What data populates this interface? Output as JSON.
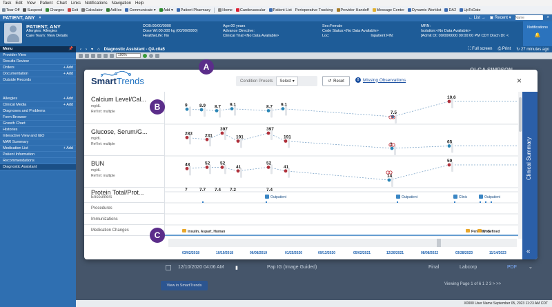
{
  "menubar": [
    "Task",
    "Edit",
    "View",
    "Patient",
    "Chart",
    "Links",
    "Notifications",
    "Navigation",
    "Help"
  ],
  "toolbar": [
    "Tear Off",
    "Suspend",
    "Charges",
    "Exit",
    "Calculator",
    "AdHoc",
    "Communicate",
    "Add",
    "Patient Pharmacy",
    "Home",
    "Cardiovascular",
    "Patient List",
    "Perioperative Tracking",
    "Provider Handoff",
    "Message Center",
    "Dynamic Worklist",
    "DA2",
    "UpToDate"
  ],
  "patientbar": {
    "name": "PATIENT, ANY",
    "list": "List",
    "recent": "Recent",
    "search_placeholder": "Name"
  },
  "demographics": {
    "name": "PATIENT, ANY",
    "allergies": "Allergies: Allergies",
    "careteam": "Care Team: View Details",
    "dob": "DOB:00/00/0000",
    "dose": "Dose Wt:00.000 kg (00/00/0000)",
    "healthelife": "HealtheLife: No",
    "age": "Age:00 years",
    "advdir": "Advance Directive:",
    "trial": "Clinical Trial:<No Data Available>",
    "sex": "Sex:Female",
    "code": "Code Status:<No Data Available>",
    "loc": "Loc:",
    "fin": "Inpatient FIN:",
    "mrn": "MRN:",
    "isolation": "Isolation:<No Data Available>",
    "admit": "[Admit Dt: 00/00/0000 00:00:00 PM CDT Disch Dt: <",
    "notifications": "Notifications"
  },
  "sidebar": {
    "header": "Menu",
    "items": [
      {
        "label": "Provider View",
        "add": ""
      },
      {
        "label": "Results Review",
        "add": ""
      },
      {
        "label": "Orders",
        "add": "+ Add"
      },
      {
        "label": "Documentation",
        "add": "+ Add"
      },
      {
        "label": "Outside Records",
        "add": ""
      },
      {
        "label": "",
        "add": ""
      },
      {
        "label": "",
        "add": ""
      },
      {
        "label": "Allergies",
        "add": "+ Add"
      },
      {
        "label": "Clinical Media",
        "add": "+ Add"
      },
      {
        "label": "Diagnoses and Problems",
        "add": ""
      },
      {
        "label": "Form Browser",
        "add": ""
      },
      {
        "label": "Growth Chart",
        "add": ""
      },
      {
        "label": "Histories",
        "add": ""
      },
      {
        "label": "Interactive View and I&O",
        "add": ""
      },
      {
        "label": "MAR Summary",
        "add": ""
      },
      {
        "label": "Medication List",
        "add": "+ Add"
      },
      {
        "label": "Patient Information",
        "add": ""
      },
      {
        "label": "Recommendations",
        "add": ""
      },
      {
        "label": "Diagnostic Assistant",
        "add": ""
      }
    ]
  },
  "content": {
    "title": "Diagnostic Assistant - QA c0a5",
    "fullscreen": "Full screen",
    "print": "Print",
    "elapsed": "27 minutes ago",
    "zoom": "100%",
    "bg_name": "OLGA SIMPSON",
    "bg_row_date": "12/10/2020 04:06 AM",
    "bg_row_test": "Pap IG (Image Guided)",
    "bg_row_status": "Final",
    "bg_row_lab": "Labcorp",
    "bg_row_pdf": "PDF",
    "pager": "Viewing Page 1 of 6   1   2   3   >   >>",
    "view_btn": "View in SmartTrends",
    "status": "X0000  User Name  September 05, 2023  11:23 AM CDT"
  },
  "modal": {
    "logo_a": "Smart",
    "logo_b": "Trends",
    "preset_label": "Condition Presets",
    "preset_value": "Select",
    "reset": "Reset",
    "missing_count": "8",
    "missing_label": "Missing Observations",
    "close": "×",
    "clinical_summary": "Clinical Summary",
    "labs": [
      {
        "name": "Calcium Level/Cal...",
        "unit": "mg/dL",
        "ref": "Ref Int: multiple"
      },
      {
        "name": "Glucose, Serum/G...",
        "unit": "mg/dL",
        "ref": "Ref Int: multiple"
      },
      {
        "name": "BUN",
        "unit": "mg/dL",
        "ref": "Ref Int: multiple"
      },
      {
        "name": "Protein Total/Prot...",
        "unit": "",
        "ref": ""
      }
    ],
    "rows": [
      "Encounters",
      "Procedures",
      "Immunizations",
      "Medication Changes"
    ],
    "encounters": [
      "Outpatient",
      "Outpatient",
      "Clinic",
      "Outpatient"
    ],
    "medications": [
      "Insulin, Aspart, Human",
      "Penicillin G",
      "Undefined"
    ],
    "dates": [
      "03/02/2018",
      "10/19/2018",
      "06/08/2019",
      "01/25/2020",
      "09/13/2020",
      "05/02/2021",
      "12/20/2021",
      "08/08/2022",
      "03/28/2023",
      "11/14/2023"
    ],
    "callouts": [
      "A",
      "B",
      "C"
    ]
  },
  "chart_data": {
    "type": "line",
    "x": [
      "03/02/2018",
      "10/19/2018",
      "06/08/2019",
      "01/25/2020",
      "09/13/2020",
      "05/02/2021",
      "12/20/2021",
      "08/08/2022",
      "03/28/2023",
      "11/14/2023"
    ],
    "series": [
      {
        "name": "Calcium Level/Cal...",
        "values": [
          9,
          8.9,
          8.7,
          9.1,
          8.7,
          9.1,
          7.5,
          10.6
        ]
      },
      {
        "name": "Glucose, Serum/G...",
        "values": [
          283,
          231,
          397,
          191,
          397,
          191,
          3,
          65
        ]
      },
      {
        "name": "BUN",
        "values": [
          48,
          52,
          52,
          41,
          52,
          41,
          14,
          59
        ]
      },
      {
        "name": "Protein Total/Prot...",
        "values": [
          7,
          7.7,
          7.4,
          7.2,
          7.4
        ]
      }
    ]
  },
  "colors": {
    "brand": "#1e5c98",
    "callout": "#5b2d8a",
    "accent": "#2b5fa8",
    "abnormal": "#b0303a",
    "normal": "#2a86b5"
  }
}
